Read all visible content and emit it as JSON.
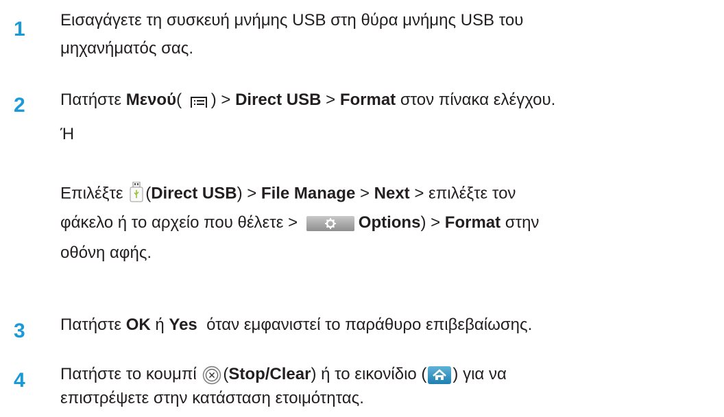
{
  "steps": [
    {
      "number": "1",
      "lines": [
        "Εισαγάγετε τη συσκευή μνήμης USB στη θύρα μνήμης USB του",
        "μηχανήματός σας."
      ]
    },
    {
      "number": "2",
      "line1": {
        "pre": "Πατήστε ",
        "menu": "Μενού",
        "paren_open": "( ",
        "paren_close": ") > ",
        "direct_usb": "Direct USB",
        "sep": " > ",
        "format": "Format",
        "post": " στον πίνακα ελέγχου."
      },
      "or": "Ή",
      "line3": {
        "pre": "Επιλέξτε ",
        "paren_open": "(",
        "direct_usb": "Direct USB",
        "paren_close": ") > ",
        "file_manage": "File Manage",
        "sep": " > ",
        "next": "Next",
        "post": " > επιλέξτε τον"
      },
      "line4": {
        "pre": "φάκελο ή το αρχείο που θέλετε > ",
        "options": "Options",
        "paren_close": ") > ",
        "format": "Format",
        "post": " στην"
      },
      "line5": "οθόνη αφής."
    },
    {
      "number": "3",
      "pre": "Πατήστε ",
      "ok": "OK",
      "mid": " ή ",
      "yes": "Yes",
      "post": "  όταν εμφανιστεί το παράθυρο επιβεβαίωσης."
    },
    {
      "number": "4",
      "line1": {
        "pre": "Πατήστε το κουμπί ",
        "paren_open": "(",
        "stop_clear": "Stop/Clear",
        "mid": ") ή το εικονίδιο (",
        "post": ") για να"
      },
      "line2": "επιστρέψετε στην κατάσταση ετοιμότητας."
    }
  ],
  "icons": {
    "menu": "menu-icon",
    "usb": "usb-drive-icon",
    "options": "gear-icon",
    "stop": "stop-clear-icon",
    "home": "home-icon"
  },
  "colors": {
    "step_number": "#1a9ad6",
    "text": "#231f20"
  }
}
